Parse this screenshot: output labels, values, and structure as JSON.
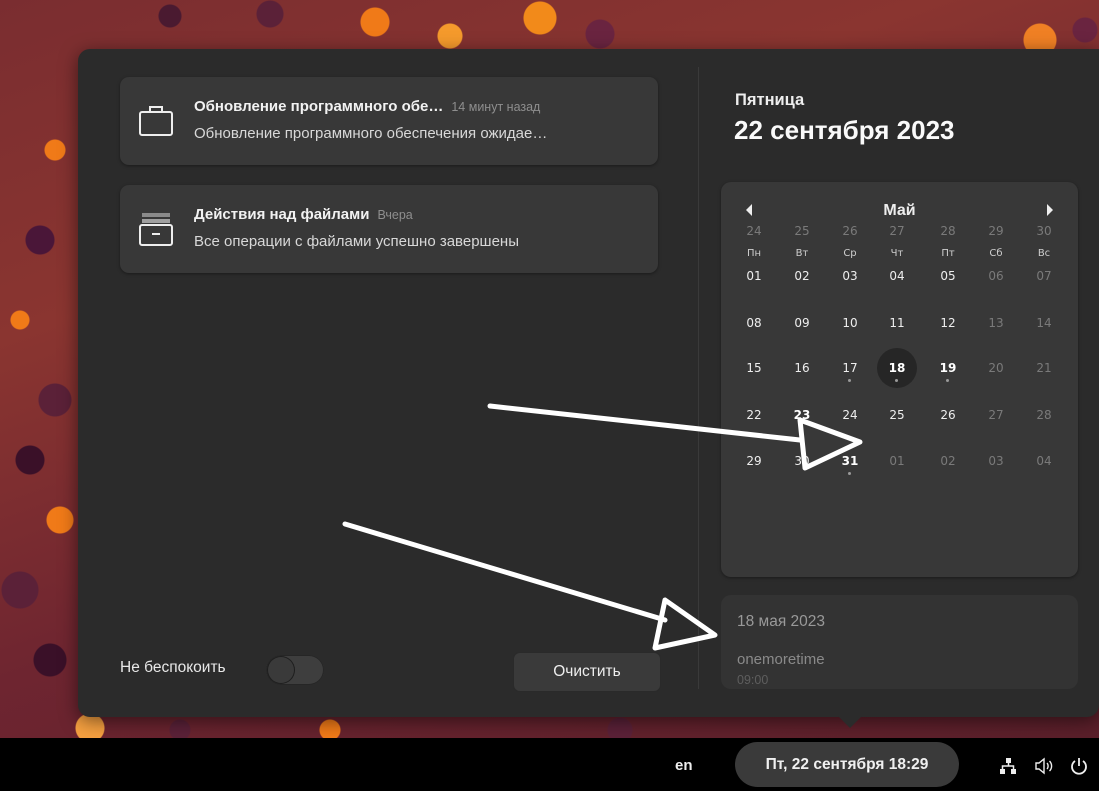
{
  "notifications": [
    {
      "title": "Обновление программного обе…",
      "time": "14 минут назад",
      "body": "Обновление программного обеспечения ожидае…",
      "icon": "briefcase-icon"
    },
    {
      "title": "Действия над файлами",
      "time": "Вчера",
      "body": "Все операции с файлами успешно завершены",
      "icon": "file-operations-icon"
    }
  ],
  "dnd": {
    "label": "Не беспокоить",
    "enabled": false
  },
  "clear_label": "Очистить",
  "date_header": {
    "weekday": "Пятница",
    "full_date": "22 сентября 2023"
  },
  "calendar": {
    "month": "Май",
    "weekdays": [
      "Пн",
      "Вт",
      "Ср",
      "Чт",
      "Пт",
      "Сб",
      "Вс"
    ],
    "weeks": [
      [
        {
          "d": "24",
          "dim": true
        },
        {
          "d": "25",
          "dim": true
        },
        {
          "d": "26",
          "dim": true
        },
        {
          "d": "27",
          "dim": true
        },
        {
          "d": "28",
          "dim": true
        },
        {
          "d": "29",
          "dim": true
        },
        {
          "d": "30",
          "dim": true
        }
      ],
      [
        {
          "d": "01"
        },
        {
          "d": "02"
        },
        {
          "d": "03"
        },
        {
          "d": "04"
        },
        {
          "d": "05"
        },
        {
          "d": "06",
          "dim": true
        },
        {
          "d": "07",
          "dim": true
        }
      ],
      [
        {
          "d": "08"
        },
        {
          "d": "09"
        },
        {
          "d": "10"
        },
        {
          "d": "11"
        },
        {
          "d": "12"
        },
        {
          "d": "13",
          "dim": true
        },
        {
          "d": "14",
          "dim": true
        }
      ],
      [
        {
          "d": "15"
        },
        {
          "d": "16"
        },
        {
          "d": "17",
          "dot": true
        },
        {
          "d": "18",
          "selected": true,
          "dot": true
        },
        {
          "d": "19",
          "bold": true,
          "dot": true
        },
        {
          "d": "20",
          "dim": true
        },
        {
          "d": "21",
          "dim": true
        }
      ],
      [
        {
          "d": "22"
        },
        {
          "d": "23",
          "bold": true,
          "dot": true
        },
        {
          "d": "24"
        },
        {
          "d": "25"
        },
        {
          "d": "26"
        },
        {
          "d": "27",
          "dim": true
        },
        {
          "d": "28",
          "dim": true
        }
      ],
      [
        {
          "d": "29"
        },
        {
          "d": "30"
        },
        {
          "d": "31",
          "bold": true,
          "dot": true
        },
        {
          "d": "01",
          "dim": true
        },
        {
          "d": "02",
          "dim": true
        },
        {
          "d": "03",
          "dim": true
        },
        {
          "d": "04",
          "dim": true
        }
      ]
    ]
  },
  "events": {
    "date": "18 мая 2023",
    "items": [
      {
        "name": "onemoretime",
        "time": "09:00"
      }
    ]
  },
  "taskbar": {
    "language": "en",
    "clock": "Пт, 22 сентября  18:29",
    "tray_icons": [
      "network-icon",
      "volume-icon",
      "power-icon"
    ]
  }
}
